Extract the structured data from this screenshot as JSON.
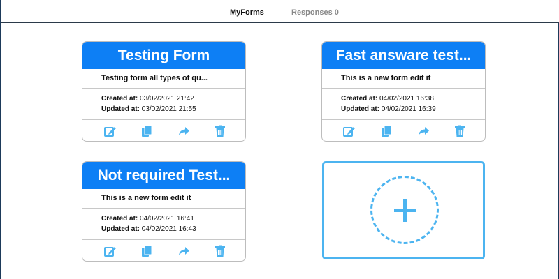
{
  "nav": {
    "tabs": [
      {
        "label": "MyForms"
      },
      {
        "label": "Responses 0"
      }
    ]
  },
  "forms": [
    {
      "title": "Testing Form",
      "description": "Testing form all types of qu...",
      "created_label": "Created at:",
      "created_value": "03/02/2021 21:42",
      "updated_label": "Updated at:",
      "updated_value": "03/02/2021 21:55"
    },
    {
      "title": "Fast answare test...",
      "description": "This is a new form edit it",
      "created_label": "Created at:",
      "created_value": "04/02/2021 16:38",
      "updated_label": "Updated at:",
      "updated_value": "04/02/2021 16:39"
    },
    {
      "title": "Not required Test...",
      "description": "This is a new form edit it",
      "created_label": "Created at:",
      "created_value": "04/02/2021 16:41",
      "updated_label": "Updated at:",
      "updated_value": "04/02/2021 16:43"
    }
  ],
  "card_actions": [
    "edit-icon",
    "copy-icon",
    "share-icon",
    "trash-icon"
  ],
  "colors": {
    "header_blue": "#0d7ff5",
    "icon_blue": "#4cb4f0"
  }
}
